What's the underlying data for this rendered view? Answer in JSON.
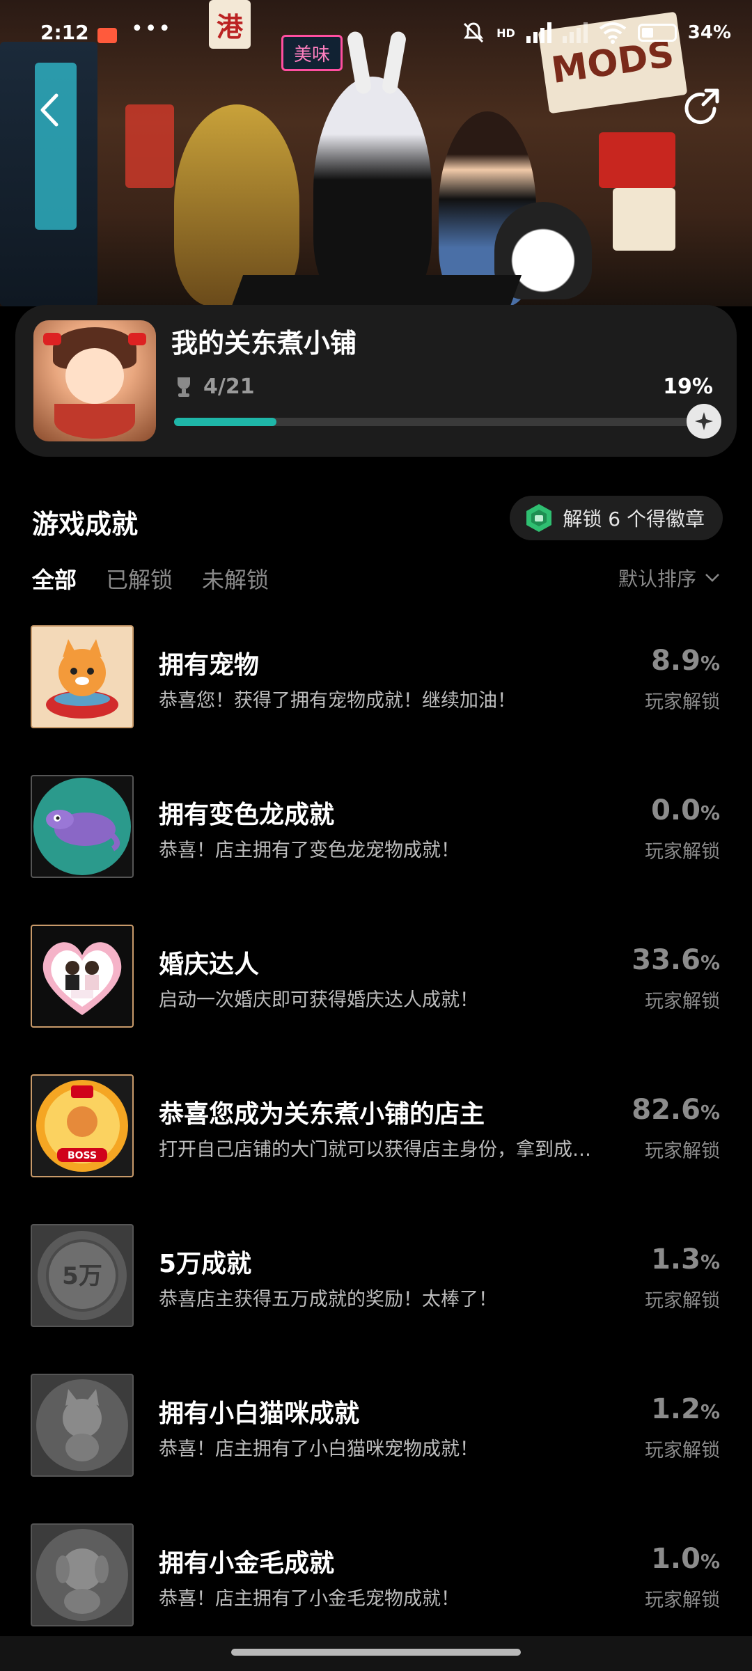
{
  "status_bar": {
    "time": "2:12",
    "dots": "•••",
    "network": "HD",
    "battery": "34%"
  },
  "banner": {
    "sign_text": "港",
    "sign_text_2": "美味",
    "sign_text_3": "MODS"
  },
  "game": {
    "title": "我的关东煮小铺",
    "unlocked_count": "4/21",
    "percent": "19%",
    "progress_fraction": 0.19
  },
  "achievements_section": {
    "title": "游戏成就",
    "badge_prompt": "解锁 6 个得徽章"
  },
  "tabs": [
    {
      "label": "全部",
      "active": true
    },
    {
      "label": "已解锁",
      "active": false
    },
    {
      "label": "未解锁",
      "active": false
    }
  ],
  "sort_label": "默认排序",
  "achievements": [
    {
      "name": "拥有宠物",
      "desc": "恭喜您！获得了拥有宠物成就！继续加油！",
      "pct_value": "8.9",
      "pct_unit": "%",
      "sub": "玩家解锁",
      "icon": "cat-bowl-icon",
      "locked": false
    },
    {
      "name": "拥有变色龙成就",
      "desc": "恭喜！店主拥有了变色龙宠物成就！",
      "pct_value": "0.0",
      "pct_unit": "%",
      "sub": "玩家解锁",
      "icon": "chameleon-icon",
      "locked": false
    },
    {
      "name": "婚庆达人",
      "desc": "启动一次婚庆即可获得婚庆达人成就！",
      "pct_value": "33.6",
      "pct_unit": "%",
      "sub": "玩家解锁",
      "icon": "wedding-heart-icon",
      "locked": false
    },
    {
      "name": "恭喜您成为关东煮小铺的店主",
      "desc": "打开自己店铺的大门就可以获得店主身份，拿到成…",
      "pct_value": "82.6",
      "pct_unit": "%",
      "sub": "玩家解锁",
      "icon": "boss-medal-icon",
      "locked": false
    },
    {
      "name": "5万成就",
      "desc": "恭喜店主获得五万成就的奖励！太棒了！",
      "pct_value": "1.3",
      "pct_unit": "%",
      "sub": "玩家解锁",
      "icon": "coin-50k-icon",
      "locked": true
    },
    {
      "name": "拥有小白猫咪成就",
      "desc": "恭喜！店主拥有了小白猫咪宠物成就！",
      "pct_value": "1.2",
      "pct_unit": "%",
      "sub": "玩家解锁",
      "icon": "white-cat-icon",
      "locked": true
    },
    {
      "name": "拥有小金毛成就",
      "desc": "恭喜！店主拥有了小金毛宠物成就！",
      "pct_value": "1.0",
      "pct_unit": "%",
      "sub": "玩家解锁",
      "icon": "golden-puppy-icon",
      "locked": true
    }
  ],
  "colors": {
    "accent": "#1fb6a8",
    "background": "#000000",
    "card": "#1c1c1c"
  }
}
